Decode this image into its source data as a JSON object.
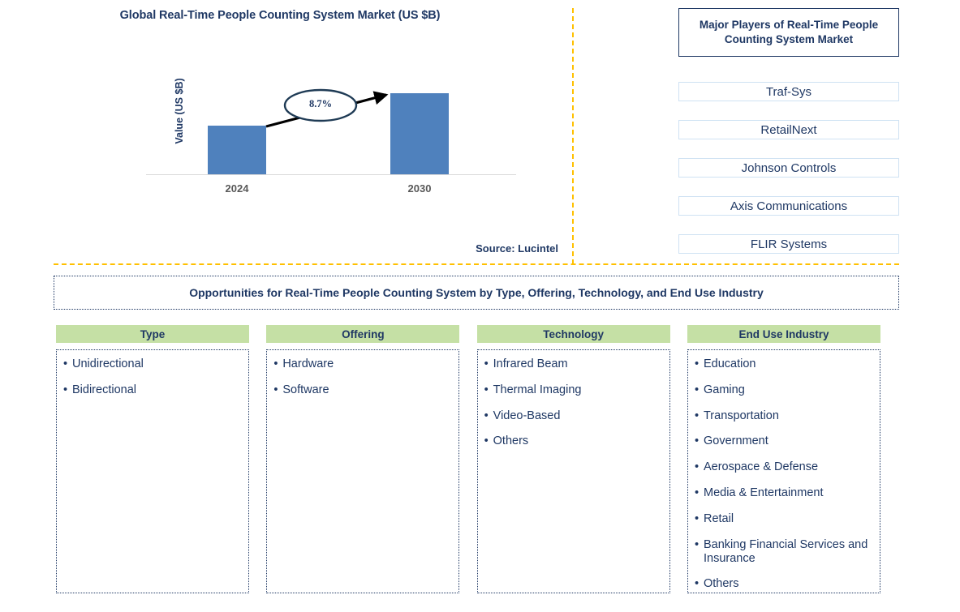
{
  "chart_panel": {
    "title": "Global Real-Time People Counting System Market (US $B)",
    "source": "Source: Lucintel"
  },
  "chart_data": {
    "type": "bar",
    "title": "Global Real-Time People Counting System Market (US $B)",
    "categories": [
      "2024",
      "2030"
    ],
    "values": [
      60,
      100
    ],
    "xlabel": "",
    "ylabel": "Value (US $B)",
    "annotations": [
      {
        "label": "8.7%",
        "type": "cagr-callout"
      }
    ],
    "grid": false,
    "legend": false,
    "series": [
      {
        "name": "Value (US $B)",
        "values": [
          60,
          100
        ],
        "color": "#4f81bd"
      }
    ]
  },
  "players": {
    "header": "Major Players of Real-Time People Counting System Market",
    "items": [
      {
        "label": "Traf-Sys"
      },
      {
        "label": "RetailNext"
      },
      {
        "label": "Johnson Controls"
      },
      {
        "label": "Axis Communications"
      },
      {
        "label": "FLIR Systems"
      }
    ]
  },
  "opportunities": {
    "banner": "Opportunities for Real-Time People Counting System by Type, Offering, Technology, and End Use Industry",
    "columns": [
      {
        "header": "Type",
        "items": [
          "Unidirectional",
          "Bidirectional"
        ]
      },
      {
        "header": "Offering",
        "items": [
          "Hardware",
          "Software"
        ]
      },
      {
        "header": "Technology",
        "items": [
          "Infrared Beam",
          "Thermal Imaging",
          "Video-Based",
          "Others"
        ]
      },
      {
        "header": "End Use Industry",
        "items": [
          "Education",
          "Gaming",
          "Transportation",
          "Government",
          "Aerospace & Defense",
          "Media & Entertainment",
          "Retail",
          "Banking Financial Services and Insurance",
          "Others"
        ]
      }
    ]
  },
  "colors": {
    "navy": "#1f3864",
    "bar_blue": "#4f81bd",
    "header_green": "#c5e0a5",
    "divider_yellow": "#ffc000",
    "tick_gray": "#595959",
    "player_border": "#cfe2f3"
  }
}
